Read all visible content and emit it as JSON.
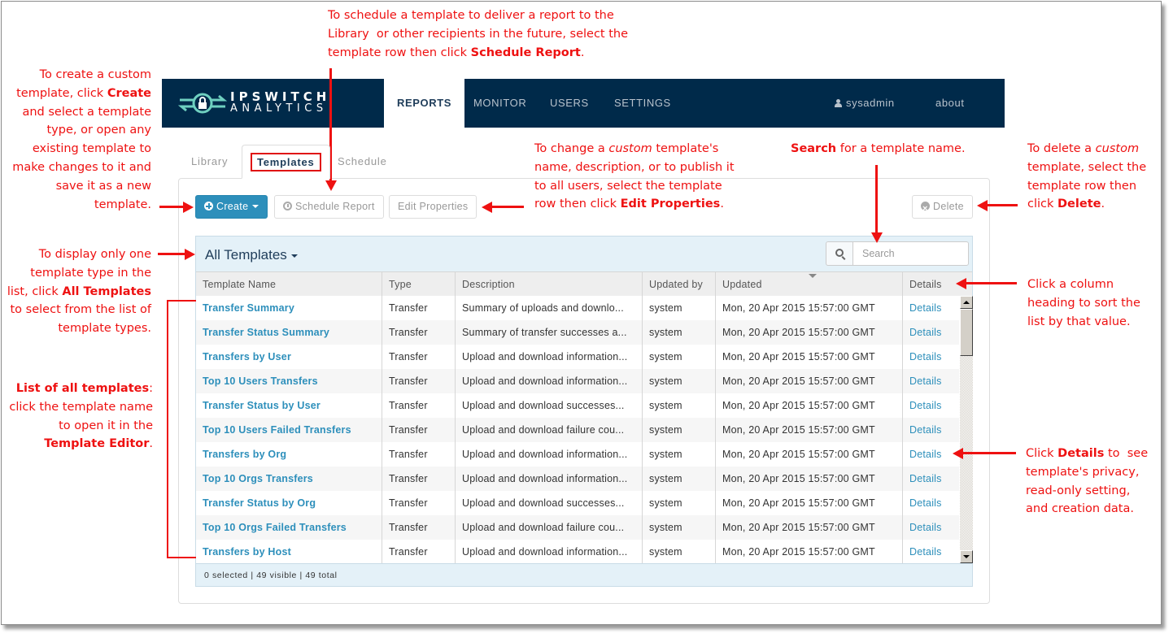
{
  "app": {
    "logo_line1": "IPSWITCH",
    "logo_line2": "ANALYTICS",
    "nav": [
      "REPORTS",
      "MONITOR",
      "USERS",
      "SETTINGS"
    ],
    "active_nav": "REPORTS",
    "user": "sysadmin",
    "about": "about"
  },
  "tabs": [
    "Library",
    "Templates",
    "Schedule"
  ],
  "active_tab": "Templates",
  "toolbar": {
    "create": "Create",
    "schedule_report": "Schedule Report",
    "edit_properties": "Edit Properties",
    "delete": "Delete"
  },
  "filter": {
    "label": "All Templates",
    "search_placeholder": "Search"
  },
  "table": {
    "columns": [
      "Template Name",
      "Type",
      "Description",
      "Updated by",
      "Updated",
      "Details"
    ],
    "sorted_column": "Updated",
    "rows": [
      {
        "name": "Transfer Summary",
        "type": "Transfer",
        "description": "Summary of uploads and downlo...",
        "updated_by": "system",
        "updated": "Mon, 20 Apr 2015 15:57:00 GMT",
        "details": "Details"
      },
      {
        "name": "Transfer Status Summary",
        "type": "Transfer",
        "description": "Summary of transfer successes a...",
        "updated_by": "system",
        "updated": "Mon, 20 Apr 2015 15:57:00 GMT",
        "details": "Details"
      },
      {
        "name": "Transfers by User",
        "type": "Transfer",
        "description": "Upload and download information...",
        "updated_by": "system",
        "updated": "Mon, 20 Apr 2015 15:57:00 GMT",
        "details": "Details"
      },
      {
        "name": "Top 10 Users Transfers",
        "type": "Transfer",
        "description": "Upload and download information...",
        "updated_by": "system",
        "updated": "Mon, 20 Apr 2015 15:57:00 GMT",
        "details": "Details"
      },
      {
        "name": "Transfer Status by User",
        "type": "Transfer",
        "description": "Upload and download successes...",
        "updated_by": "system",
        "updated": "Mon, 20 Apr 2015 15:57:00 GMT",
        "details": "Details"
      },
      {
        "name": "Top 10 Users Failed Transfers",
        "type": "Transfer",
        "description": "Upload and download failure cou...",
        "updated_by": "system",
        "updated": "Mon, 20 Apr 2015 15:57:00 GMT",
        "details": "Details"
      },
      {
        "name": "Transfers by Org",
        "type": "Transfer",
        "description": "Upload and download information...",
        "updated_by": "system",
        "updated": "Mon, 20 Apr 2015 15:57:00 GMT",
        "details": "Details"
      },
      {
        "name": "Top 10 Orgs Transfers",
        "type": "Transfer",
        "description": "Upload and download information...",
        "updated_by": "system",
        "updated": "Mon, 20 Apr 2015 15:57:00 GMT",
        "details": "Details"
      },
      {
        "name": "Transfer Status by Org",
        "type": "Transfer",
        "description": "Upload and download successes...",
        "updated_by": "system",
        "updated": "Mon, 20 Apr 2015 15:57:00 GMT",
        "details": "Details"
      },
      {
        "name": "Top 10 Orgs Failed Transfers",
        "type": "Transfer",
        "description": "Upload and download failure cou...",
        "updated_by": "system",
        "updated": "Mon, 20 Apr 2015 15:57:00 GMT",
        "details": "Details"
      },
      {
        "name": "Transfers by Host",
        "type": "Transfer",
        "description": "Upload and download information...",
        "updated_by": "system",
        "updated": "Mon, 20 Apr 2015 15:57:00 GMT",
        "details": "Details"
      }
    ],
    "footer": "0 selected | 49 visible | 49 total"
  },
  "callouts": {
    "schedule": "To schedule a template to deliver a report to the<br>Library&nbsp; or other recipients in the future, select the<br>template row then click <b>Schedule Report</b>.",
    "create": "To create a custom<br>template, click <b>Create</b><br>and select a template<br>type, or open any<br>existing template to<br>make changes to it and<br>save it as a new<br>template.",
    "edit": "To change a <i>custom</i> template's<br>name, description, or to publish it<br>to all users, select the template<br>row then click <b>Edit Properties</b>.",
    "search": "<b>Search</b> for a template name.",
    "delete": "To delete a <i>custom</i><br>template, select the<br>template row then<br>click <b>Delete</b>.",
    "filter": "To display only one<br>template type in the<br>list, click <b>All Templates</b><br>to select from the list of<br>template types.",
    "sort": "Click a column<br>heading to sort the<br>list by that value.",
    "list": "<b>List of all templates</b>:<br>click the template name<br>to open it in the<br><b>Template Editor</b>.",
    "details": "Click <b>Details</b> to&nbsp; see<br>template's privacy,<br>read-only setting,<br>and creation data."
  }
}
